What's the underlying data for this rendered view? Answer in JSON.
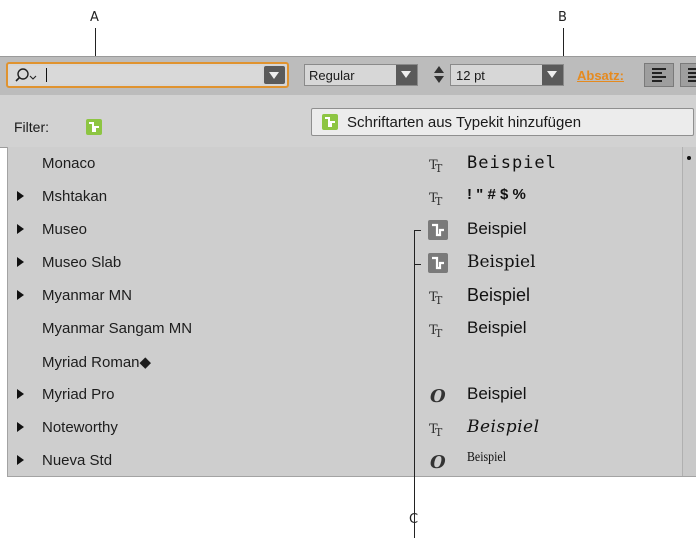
{
  "callouts": {
    "a": "A",
    "b": "B",
    "c": "C"
  },
  "toolbar": {
    "search_placeholder": "",
    "font_style": "Regular",
    "font_size": "12 pt",
    "paragraph_link": "Absatz:"
  },
  "filter": {
    "label": "Filter:",
    "typekit_button": "Schriftarten aus Typekit hinzufügen"
  },
  "fonts": [
    {
      "name": "Monaco",
      "sample": "Beispiel"
    },
    {
      "name": "Mshtakan",
      "sample": "! \" # $ %"
    },
    {
      "name": "Museo",
      "sample": "Beispiel"
    },
    {
      "name": "Museo Slab",
      "sample": "Beispiel"
    },
    {
      "name": "Myanmar MN",
      "sample": "Beispiel"
    },
    {
      "name": "Myanmar Sangam MN",
      "sample": "Beispiel"
    },
    {
      "name": "Myriad Roman◆",
      "sample": ""
    },
    {
      "name": "Myriad Pro",
      "sample": "Beispiel"
    },
    {
      "name": "Noteworthy",
      "sample": "Beispiel"
    },
    {
      "name": "Nueva Std",
      "sample": "Beispiel"
    }
  ],
  "icons": {
    "search": "search-icon",
    "truetype": "truetype-font-icon",
    "opentype": "opentype-font-icon",
    "typekit": "typekit-icon"
  },
  "colors": {
    "accent": "#e58a1f",
    "typekit_green": "#8dc542"
  }
}
